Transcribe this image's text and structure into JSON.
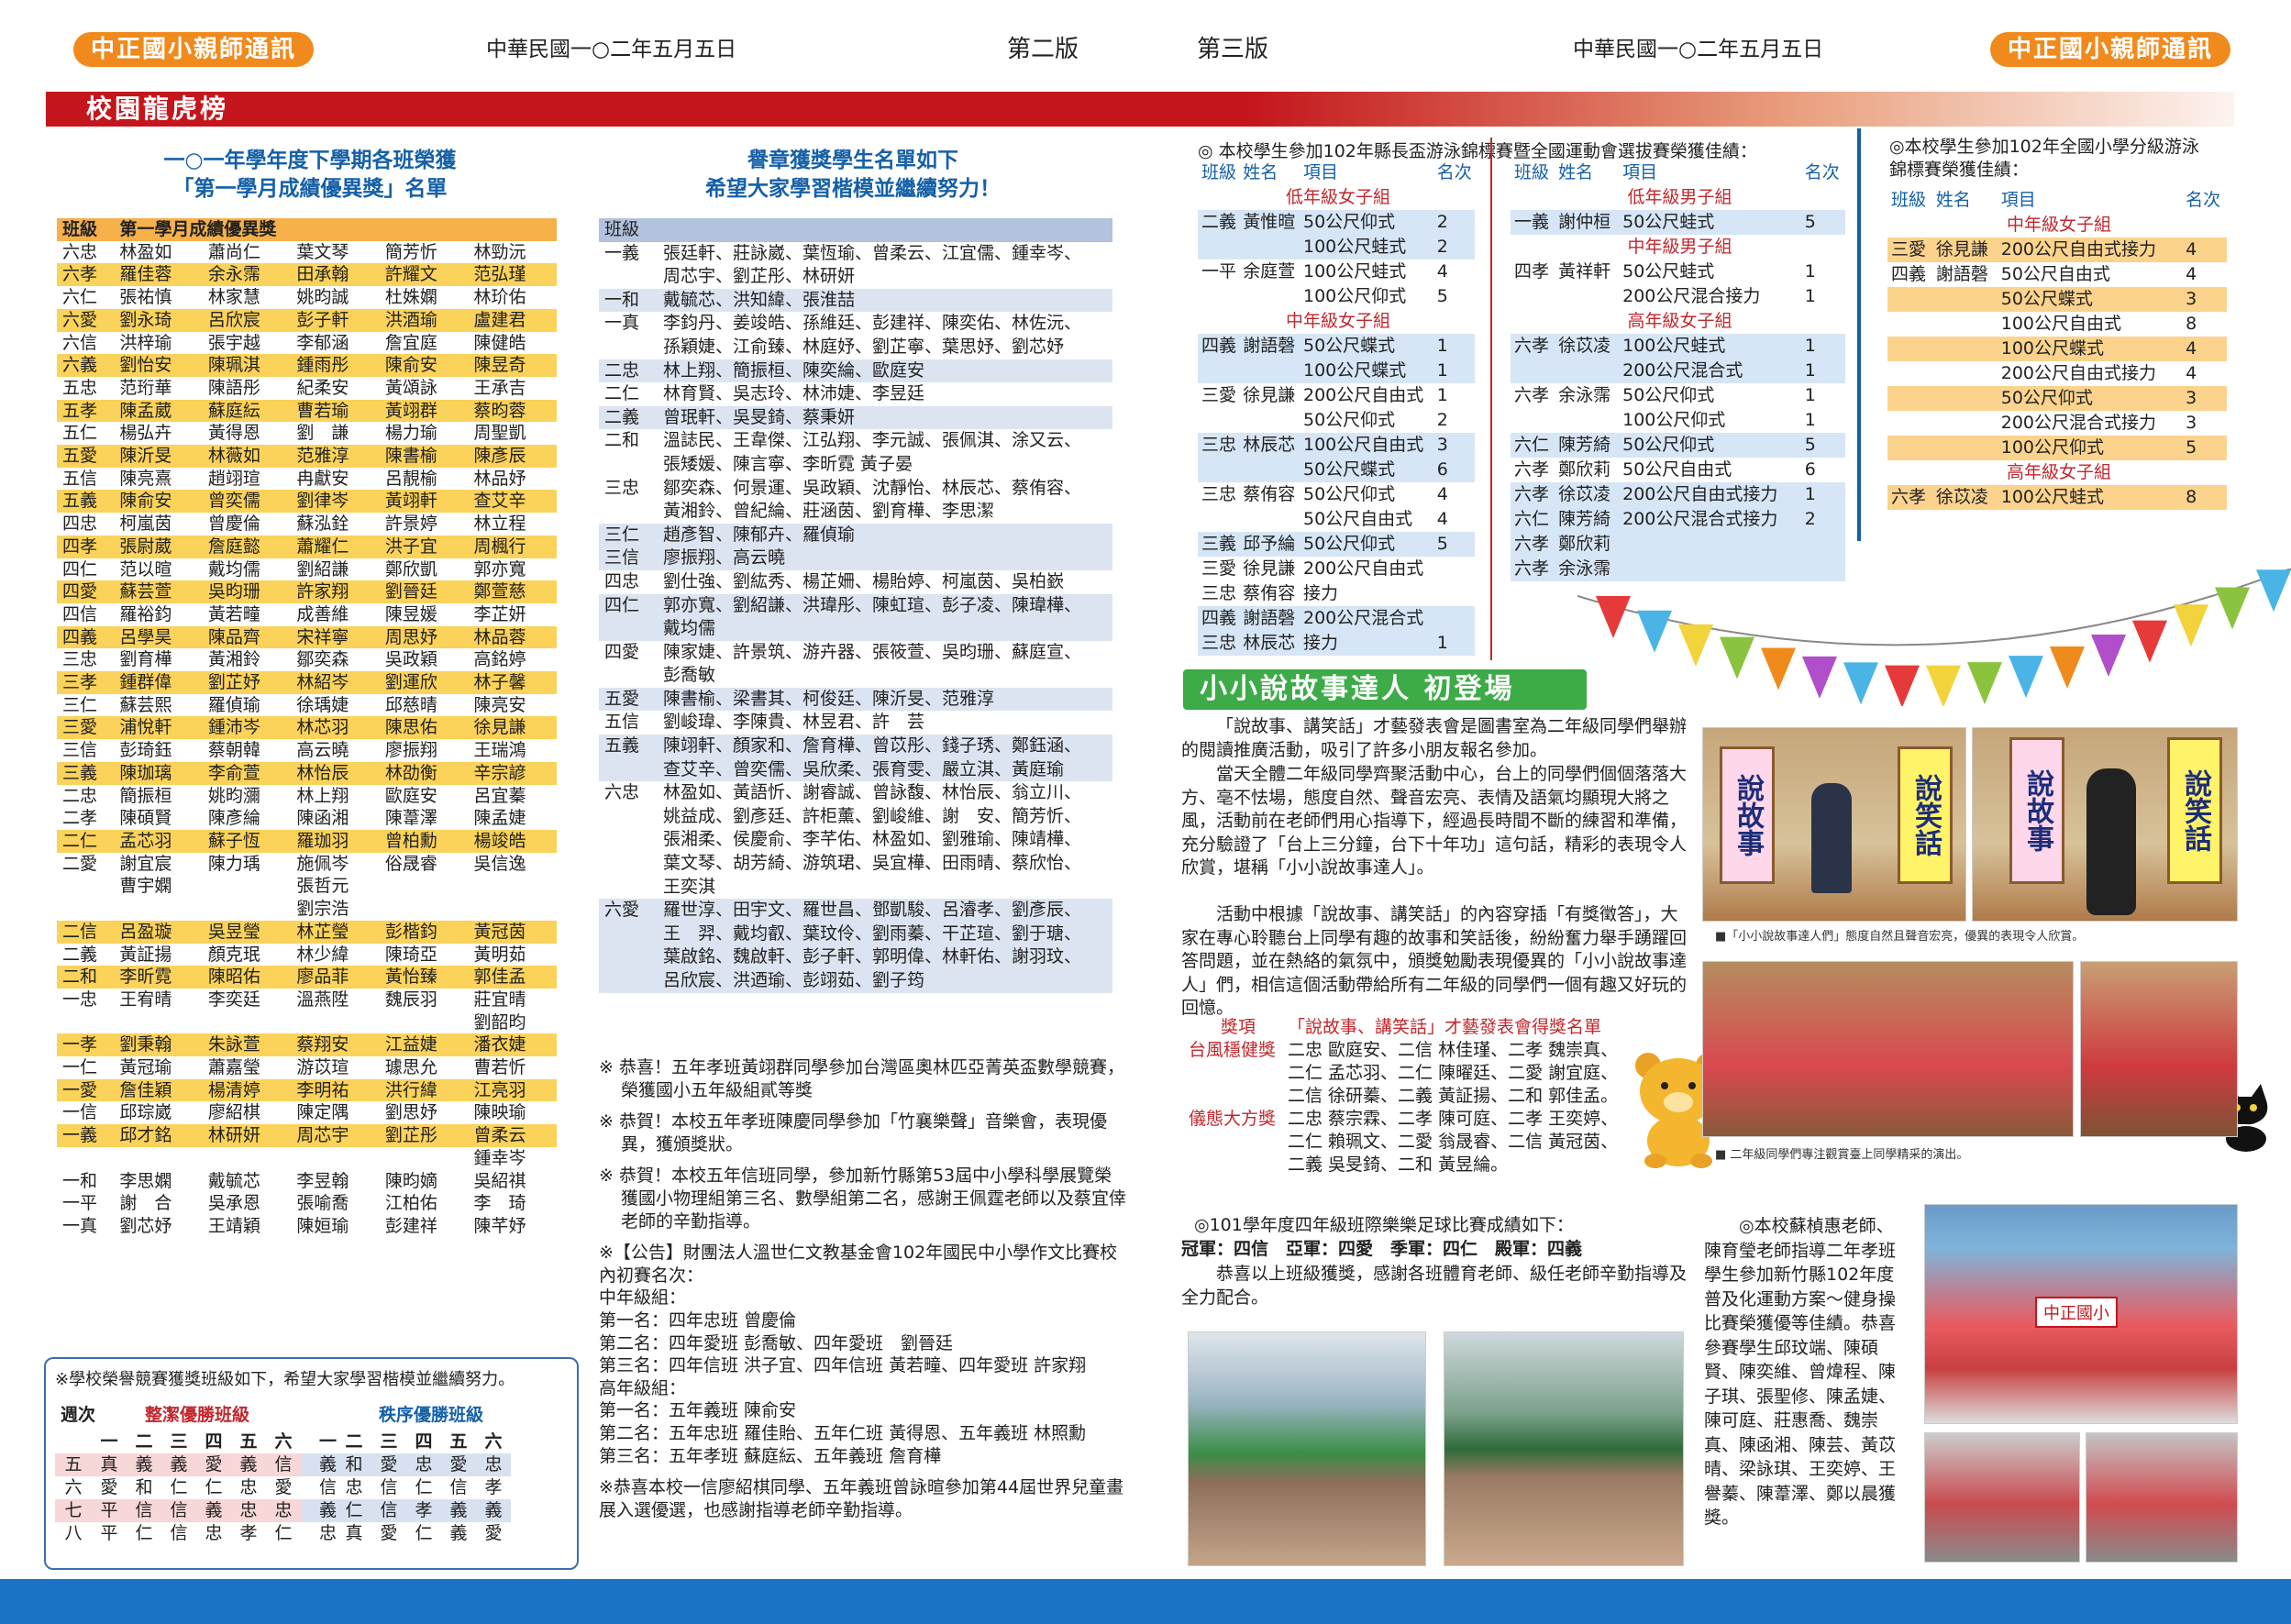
{
  "header": {
    "left_pill": "中正國小親師通訊",
    "left_date": "中華民國一○二年五月五日",
    "left_edition": "第二版",
    "right_edition": "第三版",
    "right_date": "中華民國一○二年五月五日",
    "right_pill": "中正國小親師通訊"
  },
  "banner": "校園龍虎榜",
  "honor": {
    "title1": "一○一年學年度下學期各班榮獲",
    "title2": "「第一學月成績優異獎」名單",
    "head": [
      "班級",
      "第一學月成績優異獎"
    ],
    "rows": [
      [
        "六忠",
        "林盈如",
        "蕭尚仁",
        "葉文琴",
        "簡芳忻",
        "林勁沅"
      ],
      [
        "六孝",
        "羅佳蓉",
        "余永霈",
        "田承翰",
        "許耀文",
        "范弘瑾"
      ],
      [
        "六仁",
        "張祐慎",
        "林家慧",
        "姚昀誠",
        "杜姝嫻",
        "林玠佑"
      ],
      [
        "六愛",
        "劉永琦",
        "呂欣宸",
        "彭子軒",
        "洪酒瑜",
        "盧建君"
      ],
      [
        "六信",
        "洪梓瑜",
        "張宇越",
        "李郁涵",
        "詹宜庭",
        "陳健皓"
      ],
      [
        "六義",
        "劉怡安",
        "陳珮淇",
        "鍾雨彤",
        "陳俞安",
        "陳昱奇"
      ],
      [
        "五忠",
        "范珩華",
        "陳語彤",
        "紀柔安",
        "黃頌詠",
        "王承吉"
      ],
      [
        "五孝",
        "陳孟葳",
        "蘇庭紜",
        "曹若瑜",
        "黃翊群",
        "蔡昀蓉"
      ],
      [
        "五仁",
        "楊弘卉",
        "黃得恩",
        "劉　謙",
        "楊力瑜",
        "周聖凱"
      ],
      [
        "五愛",
        "陳沂旻",
        "林薇如",
        "范雅淳",
        "陳書榆",
        "陳彥辰"
      ],
      [
        "五信",
        "陳亮熹",
        "趙翊瑄",
        "冉獻安",
        "呂靚榆",
        "林品妤"
      ],
      [
        "五義",
        "陳俞安",
        "曾奕儒",
        "劉律岑",
        "黃翊軒",
        "查艾辛"
      ],
      [
        "四忠",
        "柯嵐茵",
        "曾慶倫",
        "蘇泓銓",
        "許景婷",
        "林立程"
      ],
      [
        "四孝",
        "張尉葳",
        "詹庭懿",
        "蕭耀仁",
        "洪子宜",
        "周楓行"
      ],
      [
        "四仁",
        "范以暄",
        "戴均儒",
        "劉紹謙",
        "鄭欣凱",
        "郭亦寬"
      ],
      [
        "四愛",
        "蘇芸萱",
        "吳昀珊",
        "許家翔",
        "劉晉廷",
        "鄭萱慈"
      ],
      [
        "四信",
        "羅裕鈞",
        "黃若疃",
        "成善維",
        "陳昱媛",
        "李芷妍"
      ],
      [
        "四義",
        "呂學昊",
        "陳品齊",
        "宋祥寧",
        "周思妤",
        "林品蓉"
      ],
      [
        "三忠",
        "劉育樺",
        "黃湘鈴",
        "鄒奕森",
        "吳政穎",
        "高銘婷"
      ],
      [
        "三孝",
        "鍾群偉",
        "劉芷妤",
        "林紹岑",
        "劉運欣",
        "林子馨"
      ],
      [
        "三仁",
        "蘇芸熙",
        "羅偵瑜",
        "徐瑀婕",
        "邱慈晴",
        "陳亮安"
      ],
      [
        "三愛",
        "浦悅軒",
        "鍾沛岑",
        "林芯羽",
        "陳思佑",
        "徐見謙"
      ],
      [
        "三信",
        "彭琦鈺",
        "蔡朝韓",
        "高云曉",
        "廖振翔",
        "王瑞鴻"
      ],
      [
        "三義",
        "陳珈璃",
        "李俞萱",
        "林怡辰",
        "林劭衡",
        "辛宗諺"
      ],
      [
        "二忠",
        "簡振桓",
        "姚昀瀰",
        "林上翔",
        "歐庭安",
        "呂宜蓁"
      ],
      [
        "二孝",
        "陳碩賢",
        "陳彥綸",
        "陳函湘",
        "陳葦澤",
        "陳孟婕"
      ],
      [
        "二仁",
        "孟芯羽",
        "蘇子恆",
        "羅珈羽",
        "曾柏勳",
        "楊竣皓"
      ],
      [
        "二愛",
        "謝宜宸",
        "陳力瑀",
        "施佩岑",
        "俗晟睿",
        "吳信逸"
      ],
      [
        "",
        "曹宇嫻",
        "",
        "張哲元",
        "",
        ""
      ],
      [
        "",
        "",
        "",
        "劉宗浩",
        "",
        ""
      ],
      [
        "二信",
        "呂盈璇",
        "吳昱瑩",
        "林芷瑩",
        "彭楷鈞",
        "黃冠茵"
      ],
      [
        "二義",
        "黃証揚",
        "顏克珉",
        "林少緯",
        "陳琦亞",
        "黃明茹"
      ],
      [
        "二和",
        "李昕霓",
        "陳昭佑",
        "廖品菲",
        "黃怡臻",
        "郭佳孟"
      ],
      [
        "一忠",
        "王宥晴",
        "李奕廷",
        "溫燕陞",
        "魏辰羽",
        "莊宜晴"
      ],
      [
        "",
        "",
        "",
        "",
        "",
        "劉韶昀"
      ],
      [
        "一孝",
        "劉秉翰",
        "朱詠萱",
        "蔡翔安",
        "江益婕",
        "潘衣婕"
      ],
      [
        "一仁",
        "黃冠瑜",
        "蕭嘉瑩",
        "游苡瑄",
        "璩思允",
        "曹若忻"
      ],
      [
        "一愛",
        "詹佳穎",
        "楊清婷",
        "李明祐",
        "洪行緯",
        "江亮羽"
      ],
      [
        "一信",
        "邱琮崴",
        "廖紹棋",
        "陳定隅",
        "劉思妤",
        "陳映瑜"
      ],
      [
        "一義",
        "邱才銘",
        "林研妍",
        "周芯宇",
        "劉芷彤",
        "曾柔云"
      ],
      [
        "",
        "",
        "",
        "",
        "",
        "鍾幸岑"
      ],
      [
        "一和",
        "李思嫻",
        "戴毓芯",
        "李昱翰",
        "陳昀嫡",
        "吳紹祺"
      ],
      [
        "一平",
        "謝　合",
        "吳承恩",
        "張喻喬",
        "江柏佑",
        "李　琦"
      ],
      [
        "一真",
        "劉芯妤",
        "王靖穎",
        "陳姮瑜",
        "彭建祥",
        "陳芊妤"
      ]
    ],
    "hl_rows": [
      1,
      3,
      5,
      7,
      9,
      11,
      13,
      15,
      17,
      19,
      21,
      23,
      26,
      30,
      32,
      35,
      37,
      39
    ]
  },
  "weekly": {
    "title": "※學校榮譽競賽獲獎班級如下，希望大家學習楷模並繼續努力。",
    "col_week": "週次",
    "clean_title": "整潔優勝班級",
    "order_title": "秩序優勝班級",
    "grades": [
      "一",
      "二",
      "三",
      "四",
      "五",
      "六",
      "一",
      "二",
      "三",
      "四",
      "五",
      "六"
    ],
    "rows": [
      [
        "五",
        "真",
        "義",
        "義",
        "愛",
        "義",
        "信",
        "義",
        "和",
        "愛",
        "忠",
        "愛",
        "忠"
      ],
      [
        "六",
        "愛",
        "和",
        "仁",
        "仁",
        "忠",
        "愛",
        "信",
        "忠",
        "信",
        "仁",
        "信",
        "孝"
      ],
      [
        "七",
        "平",
        "信",
        "信",
        "義",
        "忠",
        "忠",
        "義",
        "仁",
        "信",
        "孝",
        "義",
        "義"
      ],
      [
        "八",
        "平",
        "仁",
        "信",
        "忠",
        "孝",
        "仁",
        "忠",
        "真",
        "愛",
        "仁",
        "義",
        "愛",
        "義"
      ]
    ]
  },
  "badges": {
    "title1": "譽章獲獎學生名單如下",
    "title2": "希望大家學習楷模並繼續努力！",
    "head": "班級",
    "rows": [
      [
        "一義",
        "張廷軒、莊詠崴、葉恆瑜、曾柔云、江宜儒、鍾幸岑、"
      ],
      [
        "",
        "周芯宇、劉芷彤、林研妍"
      ],
      [
        "一和",
        "戴毓芯、洪知緯、張淮喆"
      ],
      [
        "一真",
        "李鈞丹、姜竣皓、孫維廷、彭建祥、陳奕佑、林佐沅、"
      ],
      [
        "",
        "孫穎婕、江俞臻、林庭妤、劉芷寧、葉思妤、劉芯妤"
      ],
      [
        "二忠",
        "林上翔、簡振桓、陳奕綸、歐庭安"
      ],
      [
        "二仁",
        "林育賢、吳志玲、林沛婕、李昱廷"
      ],
      [
        "二義",
        "曾珉軒、吳旻錡、蔡秉妍"
      ],
      [
        "二和",
        "溫誌民、王韋傑、江弘翔、李元誠、張佩淇、涂又云、"
      ],
      [
        "",
        "張矮媛、陳言寧、李昕霓 黃子晏"
      ],
      [
        "三忠",
        "鄒奕森、何景運、吳政穎、沈靜怡、林辰芯、蔡侑容、"
      ],
      [
        "",
        "黃湘鈴、曾紀綸、莊涵茵、劉育樺、李思潔"
      ],
      [
        "三仁",
        "趙彥智、陳郁卉、羅偵瑜"
      ],
      [
        "三信",
        "廖振翔、高云曉"
      ],
      [
        "四忠",
        "劉仕強、劉紘秀、楊芷姍、楊貽婷、柯嵐茵、吳柏嶔"
      ],
      [
        "四仁",
        "郭亦寬、劉紹謙、洪瑋彤、陳虹瑄、彭子凌、陳瑋樺、"
      ],
      [
        "",
        "戴均儒"
      ],
      [
        "四愛",
        "陳家婕、許景筑、游卉器、張筱萱、吳昀珊、蘇庭宣、"
      ],
      [
        "",
        "彭喬敏"
      ],
      [
        "五愛",
        "陳書榆、梁書其、柯俊廷、陳沂旻、范雅淳"
      ],
      [
        "五信",
        "劉峻瑋、李陳貴、林昱君、許　芸"
      ],
      [
        "五義",
        "陳翊軒、顏家和、詹育樺、曾苡彤、錢子琇、鄭鈺涵、"
      ],
      [
        "",
        "查艾辛、曾奕儒、吳欣柔、張育雯、嚴立淇、黃庭瑜"
      ],
      [
        "六忠",
        "林盈如、黃語忻、謝睿誠、曾詠馥、林怡辰、翁立川、"
      ],
      [
        "",
        "姚益成、劉彥廷、許柜薰、劉峻維、謝　安、簡芳忻、"
      ],
      [
        "",
        "張湘柔、侯慶俞、李芊佑、林盈如、劉雅瑜、陳靖樺、"
      ],
      [
        "",
        "葉文琴、胡芳綺、游筑珺、吳宜樺、田雨晴、蔡欣怡、"
      ],
      [
        "",
        "王奕淇"
      ],
      [
        "六愛",
        "羅世淳、田宇文、羅世昌、鄧凱駿、呂濬孝、劉彥辰、"
      ],
      [
        "",
        "王　羿、戴均叡、葉玟伶、劉雨蓁、干芷瑄、劉于瑭、"
      ],
      [
        "",
        "葉啟銘、魏啟軒、彭子軒、郭明偉、林軒佑、謝羽玟、"
      ],
      [
        "",
        "呂欣宸、洪迺瑜、彭翊茹、劉子筠"
      ]
    ],
    "hl_rows": [
      2,
      5,
      7,
      12,
      13,
      15,
      16,
      19,
      21,
      22,
      28,
      29,
      30,
      31
    ]
  },
  "notes": [
    "※ 恭喜！五年孝班黃翊群同學參加台灣區奧林匹亞菁英盃數學競賽，榮獲國小五年級組貳等獎",
    "※ 恭賀！本校五年孝班陳慶同學參加「竹襄樂聲」音樂會，表現優異，獲頒獎狀。",
    "※ 恭賀！本校五年信班同學，參加新竹縣第53屆中小學科學展覽榮獲國小物理組第三名、數學組第二名，感謝王佩霆老師以及蔡宜倖老師的辛勤指導。",
    "※【公告】財團法人溫世仁文教基金會102年國民中小學作文比賽校內初賽名次：",
    "中年級組：",
    "第一名：四年忠班 曾慶倫",
    "第二名：四年愛班 彭喬敏、四年愛班　劉晉廷",
    "第三名：四年信班 洪子宜、四年信班 黃若疃、四年愛班 許家翔",
    "高年級組：",
    "第一名：五年義班 陳俞安",
    "第二名：五年忠班 羅佳貽、五年仁班 黃得恩、五年義班 林照勳",
    "第三名：五年孝班 蘇庭紜、五年義班 詹育樺",
    "※恭喜本校一信廖紹棋同學、五年義班曾詠暄參加第44屆世界兒童畫展入選優選，也感謝指導老師辛勤指導。"
  ],
  "swim": {
    "intro": "◎ 本校學生參加102年縣長盃游泳錦標賽暨全國運動會選拔賽榮獲佳績：",
    "cols": [
      "班級",
      "姓名",
      "項目",
      "名次"
    ],
    "left": [
      {
        "g": "低年級女子組"
      },
      {
        "r": [
          "二義",
          "黃惟暄",
          "50公尺仰式",
          "2"
        ],
        "h": 1
      },
      {
        "r": [
          "",
          "",
          "100公尺蛙式",
          "2"
        ],
        "h": 1
      },
      {
        "r": [
          "一平",
          "余庭萱",
          "100公尺蛙式",
          "4"
        ]
      },
      {
        "r": [
          "",
          "",
          "100公尺仰式",
          "5"
        ]
      },
      {
        "g": "中年級女子組"
      },
      {
        "r": [
          "四義",
          "謝語磬",
          "50公尺蝶式",
          "1"
        ],
        "h": 1
      },
      {
        "r": [
          "",
          "",
          "100公尺蝶式",
          "1"
        ],
        "h": 1
      },
      {
        "r": [
          "三愛",
          "徐見謙",
          "200公尺自由式",
          "1"
        ]
      },
      {
        "r": [
          "",
          "",
          "50公尺仰式",
          "2"
        ]
      },
      {
        "r": [
          "三忠",
          "林辰芯",
          "100公尺自由式",
          "3"
        ],
        "h": 1
      },
      {
        "r": [
          "",
          "",
          "50公尺蝶式",
          "6"
        ],
        "h": 1
      },
      {
        "r": [
          "三忠",
          "蔡侑容",
          "50公尺仰式",
          "4"
        ]
      },
      {
        "r": [
          "",
          "",
          "50公尺自由式",
          "4"
        ]
      },
      {
        "r": [
          "三義",
          "邱予綸",
          "50公尺仰式",
          "5"
        ],
        "h": 1
      },
      {
        "r": [
          "三愛",
          "徐見謙",
          "200公尺自由式",
          ""
        ]
      },
      {
        "r": [
          "三忠",
          "蔡侑容",
          "接力",
          ""
        ]
      },
      {
        "r": [
          "四義",
          "謝語磬",
          "200公尺混合式",
          ""
        ],
        "h": 1
      },
      {
        "r": [
          "三忠",
          "林辰芯",
          "接力",
          "1"
        ],
        "h": 1
      }
    ],
    "right": [
      {
        "g": "低年級男子組"
      },
      {
        "r": [
          "一義",
          "謝仲桓",
          "50公尺蛙式",
          "5"
        ],
        "h": 1
      },
      {
        "g": "中年級男子組"
      },
      {
        "r": [
          "四孝",
          "黃祥軒",
          "50公尺蛙式",
          "1"
        ]
      },
      {
        "r": [
          "",
          "",
          "200公尺混合接力",
          "1"
        ]
      },
      {
        "g": "高年級女子組"
      },
      {
        "r": [
          "六孝",
          "徐苡凌",
          "100公尺蛙式",
          "1"
        ],
        "h": 1
      },
      {
        "r": [
          "",
          "",
          "200公尺混合式",
          "1"
        ],
        "h": 1
      },
      {
        "r": [
          "六孝",
          "余泳霈",
          "50公尺仰式",
          "1"
        ]
      },
      {
        "r": [
          "",
          "",
          "100公尺仰式",
          "1"
        ]
      },
      {
        "r": [
          "六仁",
          "陳芳綺",
          "50公尺仰式",
          "5"
        ],
        "h": 1
      },
      {
        "r": [
          "六孝",
          "鄭欣莉",
          "50公尺自由式",
          "6"
        ]
      },
      {
        "r": [
          "六孝",
          "徐苡凌",
          "200公尺自由式接力",
          "1"
        ],
        "h": 1
      },
      {
        "r": [
          "六仁",
          "陳芳綺",
          "200公尺混合式接力",
          "2"
        ],
        "h": 1
      },
      {
        "r": [
          "六孝",
          "鄭欣莉",
          "",
          ""
        ],
        "h": 1
      },
      {
        "r": [
          "六孝",
          "余泳霈",
          "",
          ""
        ],
        "h": 1
      }
    ]
  },
  "nat": {
    "intro1": "◎本校學生參加102年全國小學分級游泳",
    "intro2": "錦標賽榮獲佳績：",
    "cols": [
      "班級",
      "姓名",
      "項目",
      "名次"
    ],
    "rows": [
      {
        "g": "中年級女子組"
      },
      {
        "r": [
          "三愛",
          "徐見謙",
          "200公尺自由式接力",
          "4"
        ],
        "h": 1
      },
      {
        "r": [
          "四義",
          "謝語磬",
          "50公尺自由式",
          "4"
        ]
      },
      {
        "r": [
          "",
          "",
          "50公尺蝶式",
          "3"
        ],
        "h": 1
      },
      {
        "r": [
          "",
          "",
          "100公尺自由式",
          "8"
        ]
      },
      {
        "r": [
          "",
          "",
          "100公尺蝶式",
          "4"
        ],
        "h": 1
      },
      {
        "r": [
          "",
          "",
          "200公尺自由式接力",
          "4"
        ]
      },
      {
        "r": [
          "",
          "",
          "50公尺仰式",
          "3"
        ],
        "h": 1
      },
      {
        "r": [
          "",
          "",
          "200公尺混合式接力",
          "3"
        ]
      },
      {
        "r": [
          "",
          "",
          "100公尺仰式",
          "5"
        ],
        "h": 1
      },
      {
        "g": "高年級女子組"
      },
      {
        "r": [
          "六孝",
          "徐苡凌",
          "100公尺蛙式",
          "8"
        ],
        "h": 1
      }
    ]
  },
  "story": {
    "title": "小小說故事達人 初登場",
    "p1": "「說故事、講笑話」才藝發表會是圖書室為二年級同學們舉辦的閱讀推廣活動，吸引了許多小朋友報名參加。",
    "p2": "當天全體二年級同學齊聚活動中心，台上的同學們個個落落大方、亳不怯場，態度自然、聲音宏亮、表情及語氣均顯現大將之風，活動前在老師們用心指導下，經過長時間不斷的練習和準備，充分驗證了「台上三分鐘，台下十年功」這句話，精彩的表現令人欣賞，堪稱「小小說故事達人」。",
    "p3": "活動中根據「說故事、講笑話」的內容穿插「有獎徵答」，大家在專心聆聽台上同學有趣的故事和笑話後，紛紛奮力舉手踴躍回答問題，並在熱絡的氣氛中，頒獎勉勵表現優異的「小小說故事達人」們，相信這個活動帶給所有二年級的同學們一個有趣又好玩的回憶。",
    "award_col": "獎項",
    "award_title": "「說故事、講笑話」才藝發表會得獎名單",
    "award1_name": "台風穩健獎",
    "award1_l1": "二忠 歐庭安、二信 林佳瑾、二孝 魏崇真、",
    "award1_l2": "二仁 孟芯羽、二仁 陳曜廷、二愛 謝宜庭、",
    "award1_l3": "二信 徐研蓁、二義 黃証揚、二和 郭佳孟。",
    "award2_name": "儀態大方獎",
    "award2_l1": "二忠 蔡宗霖、二孝 陳可庭、二孝 王奕婷、",
    "award2_l2": "二仁 賴珮文、二愛 翁晟睿、二信 黃冠茵、",
    "award2_l3": "二義 吳旻錡、二和 黃昱綸。",
    "cap1": "■「小小說故事達人們」態度自然且聲音宏亮，優異的表現令人欣賞。",
    "cap2": "■ 二年級同學們專注觀賞臺上同學精采的演出。",
    "sign1": "說故事",
    "sign2": "說笑話"
  },
  "football": {
    "intro": "◎101學年度四年級班際樂樂足球比賽成績如下：",
    "result": "冠軍：四信　亞軍：四愛　季軍：四仁　殿軍：四義",
    "thanks": "恭喜以上班級獲獎，感謝各班體育老師、級任老師辛勤指導及全力配合。"
  },
  "gym": {
    "text": "◎本校蘇楨惠老師、陳育瑩老師指導二年孝班學生參加新竹縣102年度普及化運動方案～健身操比賽榮獲優等佳績。恭喜參賽學生邱玟端、陳碩賢、陳奕維、曾煒程、陳子琪、張聖修、陳孟婕、陳可庭、莊惠喬、魏崇真、陳函湘、陳芸、黃苡晴、梁詠琪、王奕婷、王譽蓁、陳葦澤、鄭以晨獲獎。",
    "banner_text": "中正國小"
  },
  "colors": {
    "accent_orange": "#f08a1c",
    "banner_red": "#c4161c",
    "title_blue": "#1560a8",
    "highlight_yellow": "#fbd25a",
    "footer_blue": "#1a73c4"
  }
}
